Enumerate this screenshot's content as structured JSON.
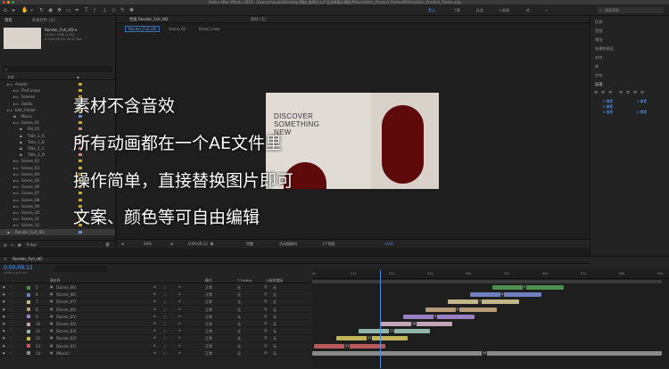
{
  "app": {
    "title": "Adobe After Effects 2020 - /Users/shiyujin/Desktop/潮物_极简主义产品成果展示模板/Minimalistic_Product_Promo/Minimalistic_Product_Promo.aep"
  },
  "toolbar": {
    "workspaces": [
      "默认",
      "了解",
      "标准",
      "小屏幕",
      "库"
    ],
    "search_placeholder": "搜索帮助"
  },
  "project": {
    "tabs": [
      "项目",
      "效果控件 (无)"
    ],
    "selected_name": "Render_Full_HD ▾",
    "selected_size": "1920 x 1080 (1.00)",
    "selected_duration": "Δ 0;00;09;13, 29.97 fps",
    "search_placeholder": "ρ",
    "column_name": "名称",
    "items": [
      {
        "label": "Assets",
        "color": "#c9a93b",
        "indent": 0,
        "type": "folder"
      },
      {
        "label": "PreComps",
        "color": "#c9a93b",
        "indent": 1,
        "type": "folder"
      },
      {
        "label": "Scenes",
        "color": "#c9a93b",
        "indent": 1,
        "type": "folder"
      },
      {
        "label": "Solids",
        "color": "#c9a93b",
        "indent": 1,
        "type": "folder"
      },
      {
        "label": "Edit_Folder",
        "color": "#c9a93b",
        "indent": 0,
        "type": "folder"
      },
      {
        "label": "Music",
        "color": "#6b8ac9",
        "indent": 1,
        "type": "file"
      },
      {
        "label": "Scene_01",
        "color": "#c9a93b",
        "indent": 1,
        "type": "folder"
      },
      {
        "label": "Pill_01",
        "color": "#c98a8a",
        "indent": 2,
        "type": "file"
      },
      {
        "label": "Title_1_A",
        "color": "#c98a8a",
        "indent": 2,
        "type": "file"
      },
      {
        "label": "Title_1_B",
        "color": "#c98a8a",
        "indent": 2,
        "type": "file"
      },
      {
        "label": "Title_1_C",
        "color": "#c98a8a",
        "indent": 2,
        "type": "file"
      },
      {
        "label": "Title_1_D",
        "color": "#c98a8a",
        "indent": 2,
        "type": "file"
      },
      {
        "label": "Scene_02",
        "color": "#c9a93b",
        "indent": 1,
        "type": "folder"
      },
      {
        "label": "Scene_03",
        "color": "#c9a93b",
        "indent": 1,
        "type": "folder"
      },
      {
        "label": "Scene_04",
        "color": "#c9a93b",
        "indent": 1,
        "type": "folder"
      },
      {
        "label": "Scene_05",
        "color": "#c9a93b",
        "indent": 1,
        "type": "folder"
      },
      {
        "label": "Scene_06",
        "color": "#c9a93b",
        "indent": 1,
        "type": "folder"
      },
      {
        "label": "Scene_07",
        "color": "#c9a93b",
        "indent": 1,
        "type": "folder"
      },
      {
        "label": "Scene_08",
        "color": "#c9a93b",
        "indent": 1,
        "type": "folder"
      },
      {
        "label": "Scene_09",
        "color": "#c9a93b",
        "indent": 1,
        "type": "folder"
      },
      {
        "label": "Scene_10",
        "color": "#c9a93b",
        "indent": 1,
        "type": "folder"
      },
      {
        "label": "Scene_11",
        "color": "#c9a93b",
        "indent": 1,
        "type": "folder"
      },
      {
        "label": "Scene_12",
        "color": "#c9a93b",
        "indent": 1,
        "type": "folder"
      },
      {
        "label": "Render_Full_HD",
        "color": "#6b8ac9",
        "indent": 0,
        "type": "comp"
      }
    ],
    "footer": "8 bpc"
  },
  "composition": {
    "tab_label": "合成 Render_Full_HD",
    "footage_tab": "素材 (无)",
    "breadcrumbs": [
      "Render_Full_HD",
      "Scene_01",
      "Email_Lines"
    ],
    "preview_text_lines": [
      "DISCOVER",
      "SOMETHING",
      "NEW"
    ],
    "accent_color": "#5e0a0a",
    "footer": {
      "zoom": "50%",
      "timecode": "0;00;09;12",
      "quality": "完整",
      "camera": "活动摄像机",
      "views": "1个视图",
      "offset": "+0.0"
    }
  },
  "overlay_text": [
    "素材不含音效",
    "所有动画都在一个AE文件里",
    "操作简单，直接替换图片即可",
    "文案、颜色等可自由编辑"
  ],
  "right_panel": {
    "items": [
      "信息",
      "音频",
      "预览",
      "效果和预设",
      "对齐",
      "库",
      "字符",
      "段落"
    ],
    "paragraph_fields": [
      "0 像素",
      "0 像素",
      "0 像素",
      "0 像素",
      "0 像素"
    ]
  },
  "timeline": {
    "tab_label": "Render_Full_HD",
    "timecode": "0;00;09;12",
    "timecode_sub": "00282 (29.97 fps)",
    "columns": [
      "源名称",
      "模式",
      "T TrkMat",
      "父级和链接"
    ],
    "ruler_labels": [
      "0s",
      "01s",
      "02s",
      "03s",
      "04s",
      "05s",
      "06s",
      "07s",
      "08s",
      "09s"
    ],
    "layers": [
      {
        "num": "5",
        "name": "[Scene_06]",
        "color": "#4c8f4c",
        "mode": "正常",
        "trkmat": "无",
        "parent": "无"
      },
      {
        "num": "6",
        "name": "[Scene_06]",
        "color": "#6f7fbf",
        "mode": "正常",
        "trkmat": "无",
        "parent": "无"
      },
      {
        "num": "7",
        "name": "[Scene_07]",
        "color": "#c2b78a",
        "mode": "正常",
        "trkmat": "无",
        "parent": "无"
      },
      {
        "num": "8",
        "name": "[Scene_06]",
        "color": "#b59a7a",
        "mode": "正常",
        "trkmat": "无",
        "parent": "无"
      },
      {
        "num": "9",
        "name": "[Scene_05]",
        "color": "#9a7fc2",
        "mode": "正常",
        "trkmat": "无",
        "parent": "无"
      },
      {
        "num": "10",
        "name": "[Scene_04]",
        "color": "#c2a4b2",
        "mode": "正常",
        "trkmat": "无",
        "parent": "无"
      },
      {
        "num": "11",
        "name": "[Scene_03]",
        "color": "#8fb5a8",
        "mode": "正常",
        "trkmat": "无",
        "parent": "无"
      },
      {
        "num": "12",
        "name": "[Scene_02]",
        "color": "#c2b258",
        "mode": "正常",
        "trkmat": "无",
        "parent": "无"
      },
      {
        "num": "13",
        "name": "[Scene_01]",
        "color": "#b85a5a",
        "mode": "正常",
        "trkmat": "无",
        "parent": "无"
      },
      {
        "num": "14",
        "name": "[Music]",
        "color": "#8a8a8a",
        "mode": "正常",
        "trkmat": "无",
        "parent": "无"
      }
    ]
  }
}
